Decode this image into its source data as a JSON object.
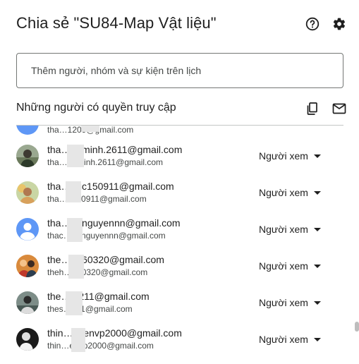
{
  "dialog": {
    "title": "Chia sẻ \"SU84-Map Vật liệu\"",
    "help_icon": "help-circle-icon",
    "settings_icon": "gear-icon"
  },
  "add_people": {
    "placeholder": "Thêm người, nhóm và sự kiện trên lịch"
  },
  "access": {
    "title": "Những người có quyền truy cập",
    "copy_icon": "copy-link-icon",
    "email_icon": "email-icon"
  },
  "people": [
    {
      "name": "",
      "email": "tha…1209@gmail.com",
      "role": ""
    },
    {
      "name": "tha…anminh.2611@gmail.com",
      "email": "tha…anminh.2611@gmail.com",
      "role": "Người xem"
    },
    {
      "name": "tha…guc150911@gmail.com",
      "email": "tha…c150911@gmail.com",
      "role": "Người xem"
    },
    {
      "name": "tha…ngnguyennn@gmail.com",
      "email": "thac…ngnguyennn@gmail.com",
      "role": "Người xem"
    },
    {
      "name": "the…g260320@gmail.com",
      "email": "theh…260320@gmail.com",
      "role": "Người xem"
    },
    {
      "name": "the…ts211@gmail.com",
      "email": "thes…211@gmail.com",
      "role": "Người xem"
    },
    {
      "name": "thin…uyenvp2000@gmail.com",
      "email": "thin…envp2000@gmail.com",
      "role": "Người xem"
    }
  ],
  "colors": {
    "default_avatar": "#5e97f6",
    "text": "#1f1f1f",
    "secondary_text": "#444746"
  }
}
